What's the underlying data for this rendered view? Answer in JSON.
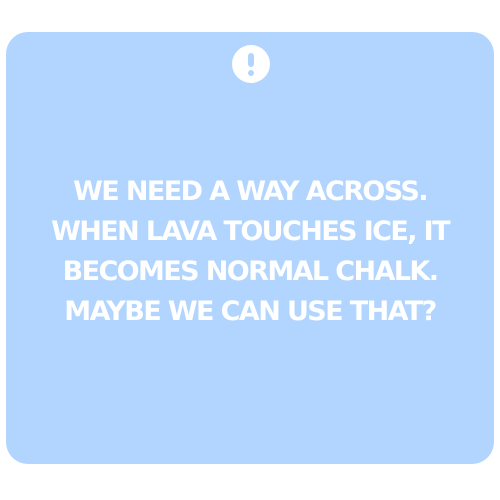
{
  "dialog": {
    "icon": "exclamation-circle-icon",
    "message_lines": [
      "WE NEED A WAY ACROSS.",
      "WHEN LAVA TOUCHES ICE, IT",
      "BECOMES NORMAL CHALK.",
      "MAYBE WE CAN USE THAT?"
    ]
  },
  "colors": {
    "card_background": "#b1d5fe",
    "text": "#ffffff",
    "page_background": "#ffffff"
  }
}
